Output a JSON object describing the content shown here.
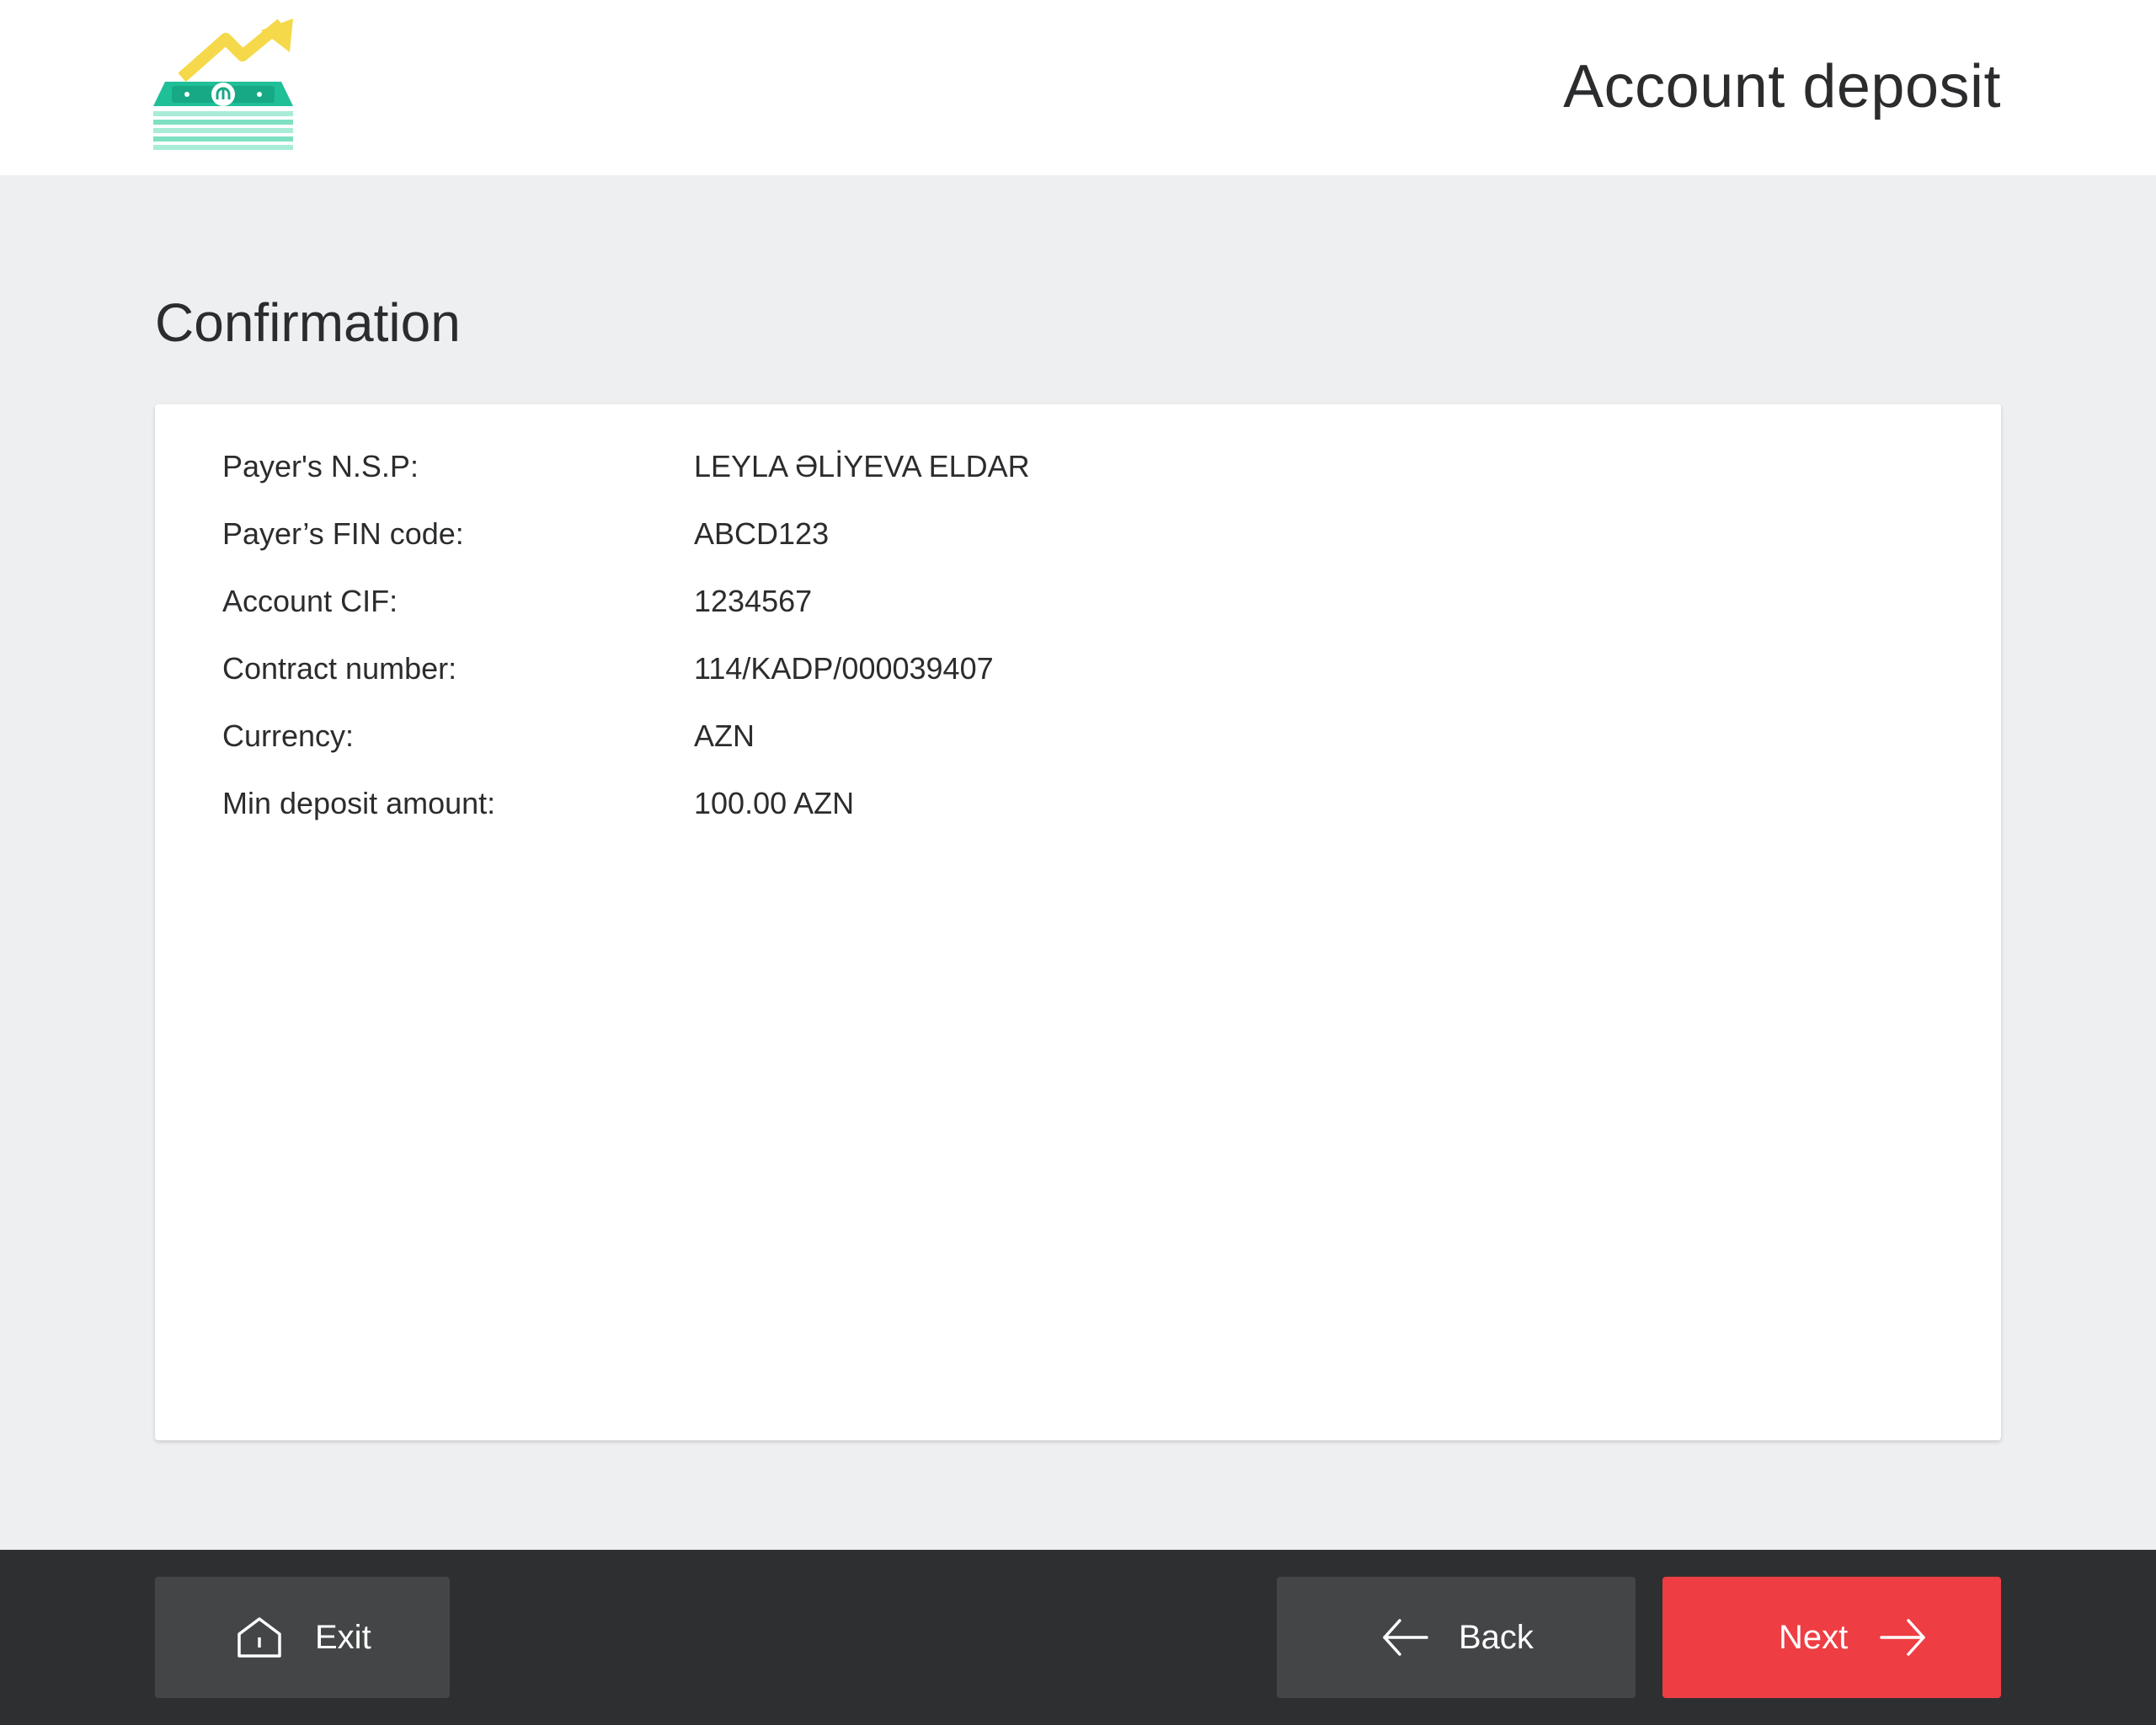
{
  "header": {
    "title": "Account deposit",
    "logo_icon": "money-growth-icon"
  },
  "section": {
    "title": "Confirmation"
  },
  "details": [
    {
      "label": "Payer's N.S.P:",
      "value": "LEYLA ƏLİYEVA ELDAR"
    },
    {
      "label": "Payer’s FIN code:",
      "value": "ABCD123"
    },
    {
      "label": "Account CIF:",
      "value": "1234567"
    },
    {
      "label": "Contract number:",
      "value": "114/KADP/000039407"
    },
    {
      "label": "Currency:",
      "value": "AZN"
    },
    {
      "label": "Min deposit amount:",
      "value": "100.00 AZN"
    }
  ],
  "footer": {
    "exit_label": "Exit",
    "exit_icon": "home-icon",
    "back_label": "Back",
    "back_icon": "arrow-left-icon",
    "next_label": "Next",
    "next_icon": "arrow-right-icon"
  },
  "colors": {
    "accent": "#ee3e43",
    "footer_bg": "#2e2f31",
    "button_dark": "#444547",
    "page_bg": "#eeeff1",
    "logo_green": "#1fbf98",
    "logo_yellow": "#f5d94a"
  }
}
